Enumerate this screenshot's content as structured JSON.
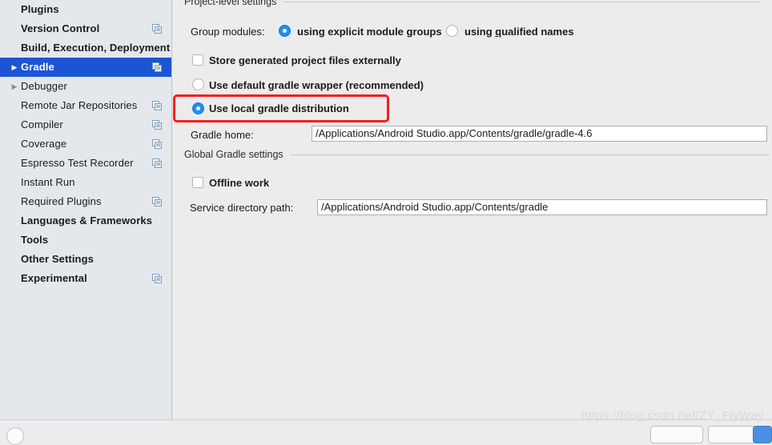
{
  "sidebar": {
    "items": [
      {
        "label": "Plugins",
        "bold": true,
        "twisty": "none",
        "indent": 0,
        "copy": false,
        "selected": false
      },
      {
        "label": "Version Control",
        "bold": true,
        "twisty": "none",
        "indent": 0,
        "copy": true,
        "selected": false
      },
      {
        "label": "Build, Execution, Deployment",
        "bold": true,
        "twisty": "none",
        "indent": 0,
        "copy": false,
        "selected": false
      },
      {
        "label": "Gradle",
        "bold": true,
        "twisty": "collapsed",
        "indent": 1,
        "copy": true,
        "selected": true
      },
      {
        "label": "Debugger",
        "bold": false,
        "twisty": "collapsed",
        "indent": 1,
        "copy": false,
        "selected": false
      },
      {
        "label": "Remote Jar Repositories",
        "bold": false,
        "twisty": "none",
        "indent": 1,
        "copy": true,
        "selected": false
      },
      {
        "label": "Compiler",
        "bold": false,
        "twisty": "none",
        "indent": 1,
        "copy": true,
        "selected": false
      },
      {
        "label": "Coverage",
        "bold": false,
        "twisty": "none",
        "indent": 1,
        "copy": true,
        "selected": false
      },
      {
        "label": "Espresso Test Recorder",
        "bold": false,
        "twisty": "none",
        "indent": 1,
        "copy": true,
        "selected": false
      },
      {
        "label": "Instant Run",
        "bold": false,
        "twisty": "none",
        "indent": 1,
        "copy": false,
        "selected": false
      },
      {
        "label": "Required Plugins",
        "bold": false,
        "twisty": "none",
        "indent": 1,
        "copy": true,
        "selected": false
      },
      {
        "label": "Languages & Frameworks",
        "bold": true,
        "twisty": "none",
        "indent": 0,
        "copy": false,
        "selected": false
      },
      {
        "label": "Tools",
        "bold": true,
        "twisty": "none",
        "indent": 0,
        "copy": false,
        "selected": false
      },
      {
        "label": "Other Settings",
        "bold": true,
        "twisty": "none",
        "indent": 0,
        "copy": false,
        "selected": false
      },
      {
        "label": "Experimental",
        "bold": true,
        "twisty": "none",
        "indent": 0,
        "copy": true,
        "selected": false
      }
    ],
    "selected_label": "Gradle",
    "icon_name": "copy-icon",
    "selection_color": "#1b55d4"
  },
  "main": {
    "project_group": {
      "title": "Project-level settings"
    },
    "group_modules": {
      "label": "Group modules:",
      "options": [
        {
          "label_before": "using explicit module ",
          "mnemonic": "g",
          "label_after": "roups",
          "selected": true
        },
        {
          "label_before": "using ",
          "mnemonic": "q",
          "label_after": "ualified names",
          "selected": false
        }
      ]
    },
    "store_generated": {
      "label": "Store generated project files externally",
      "checked": false
    },
    "gradle_source": {
      "options": [
        {
          "label": "Use default gradle wrapper (recommended)",
          "selected": false
        },
        {
          "label": "Use local gradle distribution",
          "selected": true
        }
      ],
      "highlight_color": "#f81d1d",
      "highlighted_option": "Use local gradle distribution"
    },
    "gradle_home": {
      "label": "Gradle home:",
      "value": "/Applications/Android Studio.app/Contents/gradle/gradle-4.6"
    },
    "global_group": {
      "title": "Global Gradle settings"
    },
    "offline_work": {
      "label": "Offline work",
      "checked": false
    },
    "service_directory": {
      "label": "Service directory path:",
      "value": "/Applications/Android Studio.app/Contents/gradle"
    }
  },
  "watermark": {
    "text": "https://blog.csdn.net/ZY_FlyWay"
  },
  "footer": {
    "help_label": "?",
    "buttons": [
      {
        "label": "",
        "primary": false
      },
      {
        "label": "",
        "primary": false
      },
      {
        "label": "",
        "primary": true
      }
    ]
  }
}
